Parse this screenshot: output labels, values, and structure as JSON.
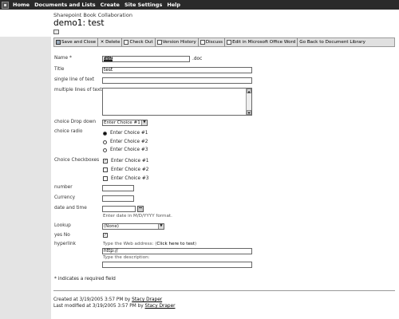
{
  "topnav": {
    "items": [
      "Home",
      "Documents and Lists",
      "Create",
      "Site Settings",
      "Help"
    ]
  },
  "header": {
    "site_name": "Sharepoint Book Collaboration",
    "title": "demo1: test"
  },
  "toolbar": {
    "buttons": [
      {
        "label": "Save and Close",
        "icon": "save-icon"
      },
      {
        "label": "Delete",
        "icon": "delete-icon"
      },
      {
        "label": "Check Out",
        "icon": "check-out-icon"
      },
      {
        "label": "Version History",
        "icon": "version-history-icon"
      },
      {
        "label": "Discuss",
        "icon": "discuss-icon"
      },
      {
        "label": "Edit in Microsoft Office Word",
        "icon": "word-icon"
      },
      {
        "label": "Go Back to Document Library",
        "icon": ""
      }
    ]
  },
  "form": {
    "name": {
      "label": "Name *",
      "value": "test",
      "suffix": ".doc"
    },
    "title": {
      "label": "Title",
      "value": "test"
    },
    "single_line": {
      "label": "single line of text",
      "value": ""
    },
    "multi_line": {
      "label": "multiple lines of text",
      "value": ""
    },
    "dropdown": {
      "label": "choice Drop down",
      "value": "Enter Choice #1"
    },
    "radio": {
      "label": "choice radio",
      "options": [
        "Enter Choice #1",
        "Enter Choice #2",
        "Enter Choice #3"
      ],
      "selected": 0
    },
    "checkboxes": {
      "label": "Choice Checkboxes",
      "options": [
        "Enter Choice #1",
        "Enter Choice #2",
        "Enter Choice #3"
      ],
      "checked": [
        true,
        false,
        false
      ]
    },
    "number": {
      "label": "number",
      "value": ""
    },
    "currency": {
      "label": "Currency",
      "value": ""
    },
    "date": {
      "label": "date and time",
      "value": "",
      "hint": "Enter date in M/D/YYYY format."
    },
    "lookup": {
      "label": "Lookup",
      "value": "(None)"
    },
    "yesno": {
      "label": "yes No",
      "checked": true
    },
    "hyperlink": {
      "label": "hyperlink",
      "url_hint": "Type the Web address: (",
      "url_link": "Click here to test",
      "url_hint_end": ")",
      "url_value": "http://",
      "desc_hint": "Type the description:",
      "desc_value": ""
    }
  },
  "required_note": "* indicates a required field",
  "footer": {
    "created_prefix": "Created at 3/19/2005 3:57 PM by ",
    "created_by": "Stacy Draper",
    "modified_prefix": "Last modified at 3/19/2005 3:57 PM by ",
    "modified_by": "Stacy Draper"
  }
}
